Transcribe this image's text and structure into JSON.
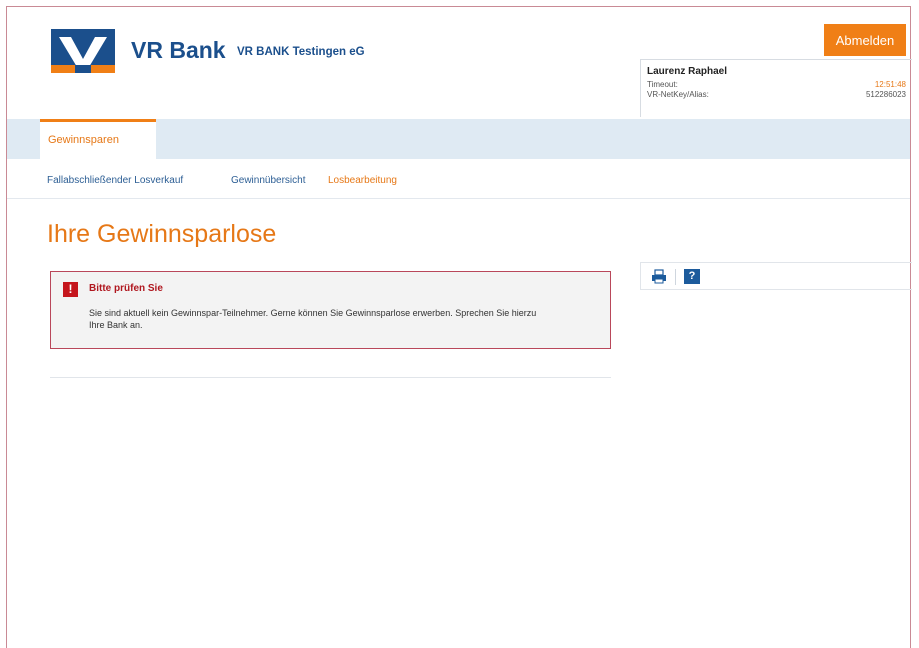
{
  "header": {
    "bank_name": "VR Bank",
    "bank_subtitle": "VR BANK Testingen eG",
    "logout_label": "Abmelden",
    "user": {
      "name": "Laurenz Raphael",
      "timeout_label": "Timeout:",
      "timeout_value": "12:51:48",
      "alias_label": "VR-NetKey/Alias:",
      "alias_value": "512286023"
    }
  },
  "tabs": [
    {
      "label": "Gewinnsparen",
      "active": true
    }
  ],
  "subnav": [
    {
      "label": "Fallabschließender Losverkauf",
      "active": false
    },
    {
      "label": "Gewinnübersicht",
      "active": false
    },
    {
      "label": "Losbearbeitung",
      "active": true
    }
  ],
  "main": {
    "title": "Ihre Gewinnsparlose",
    "alert": {
      "title": "Bitte prüfen Sie",
      "message": "Sie sind aktuell kein Gewinnspar-Teilnehmer. Gerne können Sie Gewinnsparlose erwerben. Sprechen Sie hierzu Ihre Bank an."
    }
  },
  "tools": {
    "icons": [
      "print-icon",
      "help-icon"
    ],
    "help_glyph": "?"
  },
  "colors": {
    "accent_orange": "#f07f16",
    "brand_blue": "#1b4f8c",
    "error_red": "#c5161d"
  }
}
